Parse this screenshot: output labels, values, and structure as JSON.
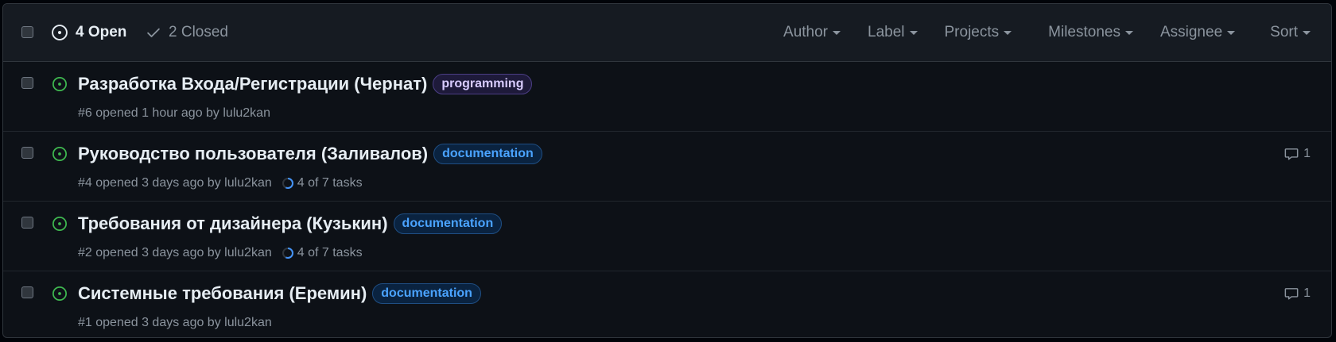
{
  "header": {
    "open_count": "4 Open",
    "closed_count": "2 Closed",
    "filters": {
      "author": "Author",
      "label": "Label",
      "projects": "Projects",
      "milestones": "Milestones",
      "assignee": "Assignee",
      "sort": "Sort"
    }
  },
  "issues": [
    {
      "title": "Разработка Входа/Регистрации (Чернат)",
      "label": "programming",
      "meta": "#6 opened 1 hour ago by lulu2kan",
      "tasks": "",
      "comments": ""
    },
    {
      "title": "Руководство пользователя (Заливалов)",
      "label": "documentation",
      "meta": "#4 opened 3 days ago by lulu2kan",
      "tasks": "4 of 7 tasks",
      "tasks_progress": 0.57,
      "comments": "1"
    },
    {
      "title": "Требования от дизайнера (Кузькин)",
      "label": "documentation",
      "meta": "#2 opened 3 days ago by lulu2kan",
      "tasks": "4 of 7 tasks",
      "tasks_progress": 0.57,
      "comments": ""
    },
    {
      "title": "Системные требования (Еремин)",
      "label": "documentation",
      "meta": "#1 opened 3 days ago by lulu2kan",
      "tasks": "",
      "comments": "1"
    }
  ],
  "colors": {
    "open_icon": "#3fb950",
    "label_programming": "#d8cbff",
    "label_documentation": "#4aa3ff",
    "task_progress": "#4493f8"
  }
}
